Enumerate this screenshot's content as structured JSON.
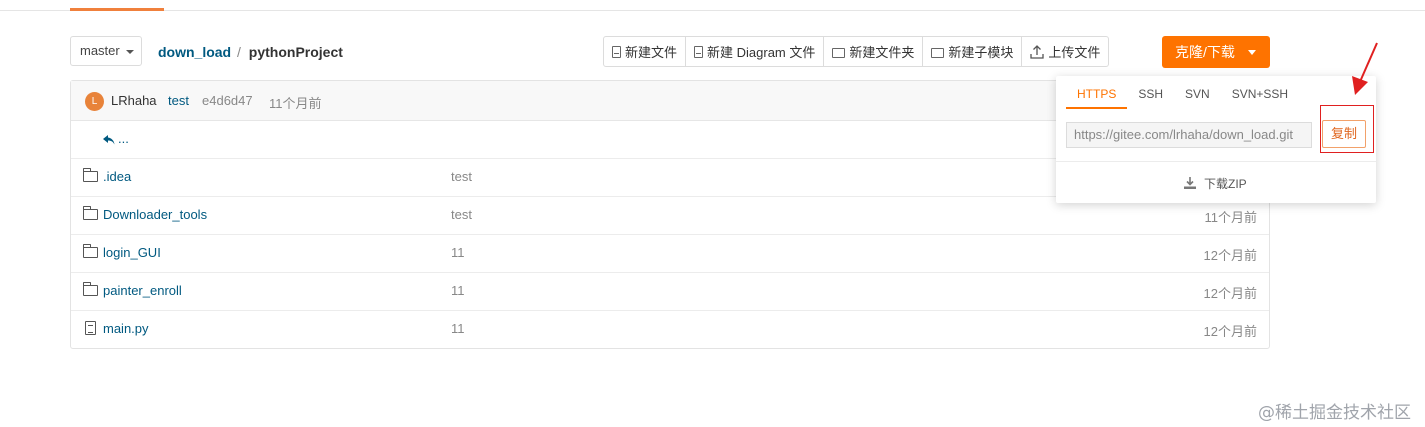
{
  "branch": {
    "name": "master"
  },
  "breadcrumb": {
    "repo": "down_load",
    "separator": "/",
    "project": "pythonProject"
  },
  "toolbar": {
    "new_file": "新建文件",
    "new_diagram": "新建 Diagram 文件",
    "new_folder": "新建文件夹",
    "new_submodule": "新建子模块",
    "upload": "上传文件"
  },
  "clone_button": {
    "label": "克隆/下载"
  },
  "commit": {
    "avatar_letter": "L",
    "author": "LRhaha",
    "message": "test",
    "hash": "e4d6d47",
    "time": "11个月前"
  },
  "back_link": "...",
  "files": [
    {
      "name": ".idea",
      "type": "folder",
      "message": "test",
      "date": ""
    },
    {
      "name": "Downloader_tools",
      "type": "folder",
      "message": "test",
      "date": "11个月前"
    },
    {
      "name": "login_GUI",
      "type": "folder",
      "message": "11",
      "date": "12个月前"
    },
    {
      "name": "painter_enroll",
      "type": "folder",
      "message": "11",
      "date": "12个月前"
    },
    {
      "name": "main.py",
      "type": "file",
      "message": "11",
      "date": "12个月前"
    }
  ],
  "clone_dropdown": {
    "tabs": [
      "HTTPS",
      "SSH",
      "SVN",
      "SVN+SSH"
    ],
    "active_tab": "HTTPS",
    "url": "https://gitee.com/lrhaha/down_load.git",
    "copy_label": "复制",
    "zip_label": "下载ZIP"
  },
  "watermark": "@稀土掘金技术社区",
  "colors": {
    "accent": "#fe7300",
    "link": "#005980",
    "highlight": "#e02020"
  }
}
